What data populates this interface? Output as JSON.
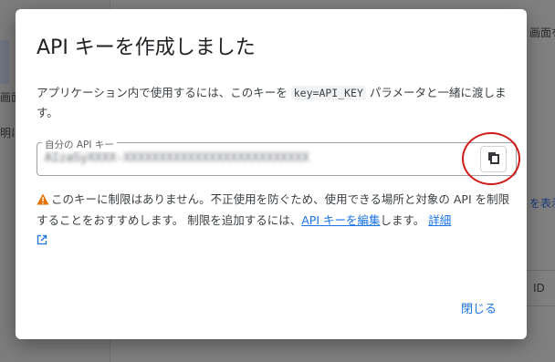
{
  "background": {
    "right_texts": [
      "画面を",
      "を表示",
      "ID"
    ],
    "left_texts": [
      "画面",
      "明に"
    ]
  },
  "dialog": {
    "title": "API キーを作成しました",
    "description_before": "アプリケーション内で使用するには、このキーを",
    "description_code": "key=API_KEY",
    "description_after": "パラメータと一緒に渡します。",
    "key_field": {
      "label": "自分の API キー",
      "value": "AIzaSyXXXX-XXXXXXXXXXXXXXXXXXXXXXXXXX",
      "copy_icon": "copy-icon"
    },
    "warning": {
      "icon": "warning-icon",
      "text_before": "このキーに制限はありません。不正使用を防ぐため、使用できる場所と対象の API を制限することをおすすめします。 制限を追加するには、",
      "link_edit": "API キーを編集",
      "text_middle": "します。",
      "link_details": "詳細",
      "external_icon": "external-link-icon"
    },
    "close_label": "閉じる"
  },
  "colors": {
    "accent": "#1a73e8",
    "warning": "#e37400",
    "highlight_circle": "#d11a1a"
  }
}
